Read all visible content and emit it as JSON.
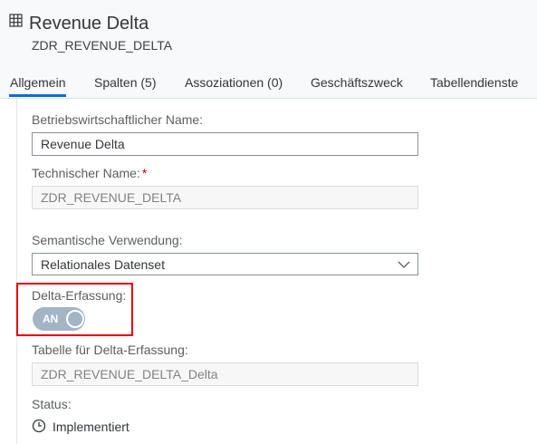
{
  "header": {
    "icon": "table-icon",
    "title": "Revenue Delta",
    "subtitle": "ZDR_REVENUE_DELTA"
  },
  "tabs": [
    {
      "label": "Allgemein",
      "selected": true
    },
    {
      "label": "Spalten (5)",
      "selected": false
    },
    {
      "label": "Assoziationen (0)",
      "selected": false
    },
    {
      "label": "Geschäftszweck",
      "selected": false
    },
    {
      "label": "Tabellendienste",
      "selected": false
    }
  ],
  "form": {
    "business_name": {
      "label": "Betriebswirtschaftlicher Name:",
      "value": "Revenue Delta"
    },
    "technical_name": {
      "label": "Technischer Name:",
      "required_mark": "*",
      "value": "ZDR_REVENUE_DELTA"
    },
    "semantic_usage": {
      "label": "Semantische Verwendung:",
      "value": "Relationales Datenset",
      "icon": "chevron-down-icon"
    },
    "delta_capture": {
      "label": "Delta-Erfassung:",
      "state_label": "AN",
      "enabled": true
    },
    "delta_table": {
      "label": "Tabelle für Delta-Erfassung:",
      "value": "ZDR_REVENUE_DELTA_Delta"
    },
    "status": {
      "label": "Status:",
      "value": "Implementiert",
      "icon": "clock-icon"
    }
  },
  "colors": {
    "accent": "#0a6ed1",
    "highlight": "#e3000f",
    "toggle": "#a3b4c5",
    "required": "#bb0000"
  }
}
